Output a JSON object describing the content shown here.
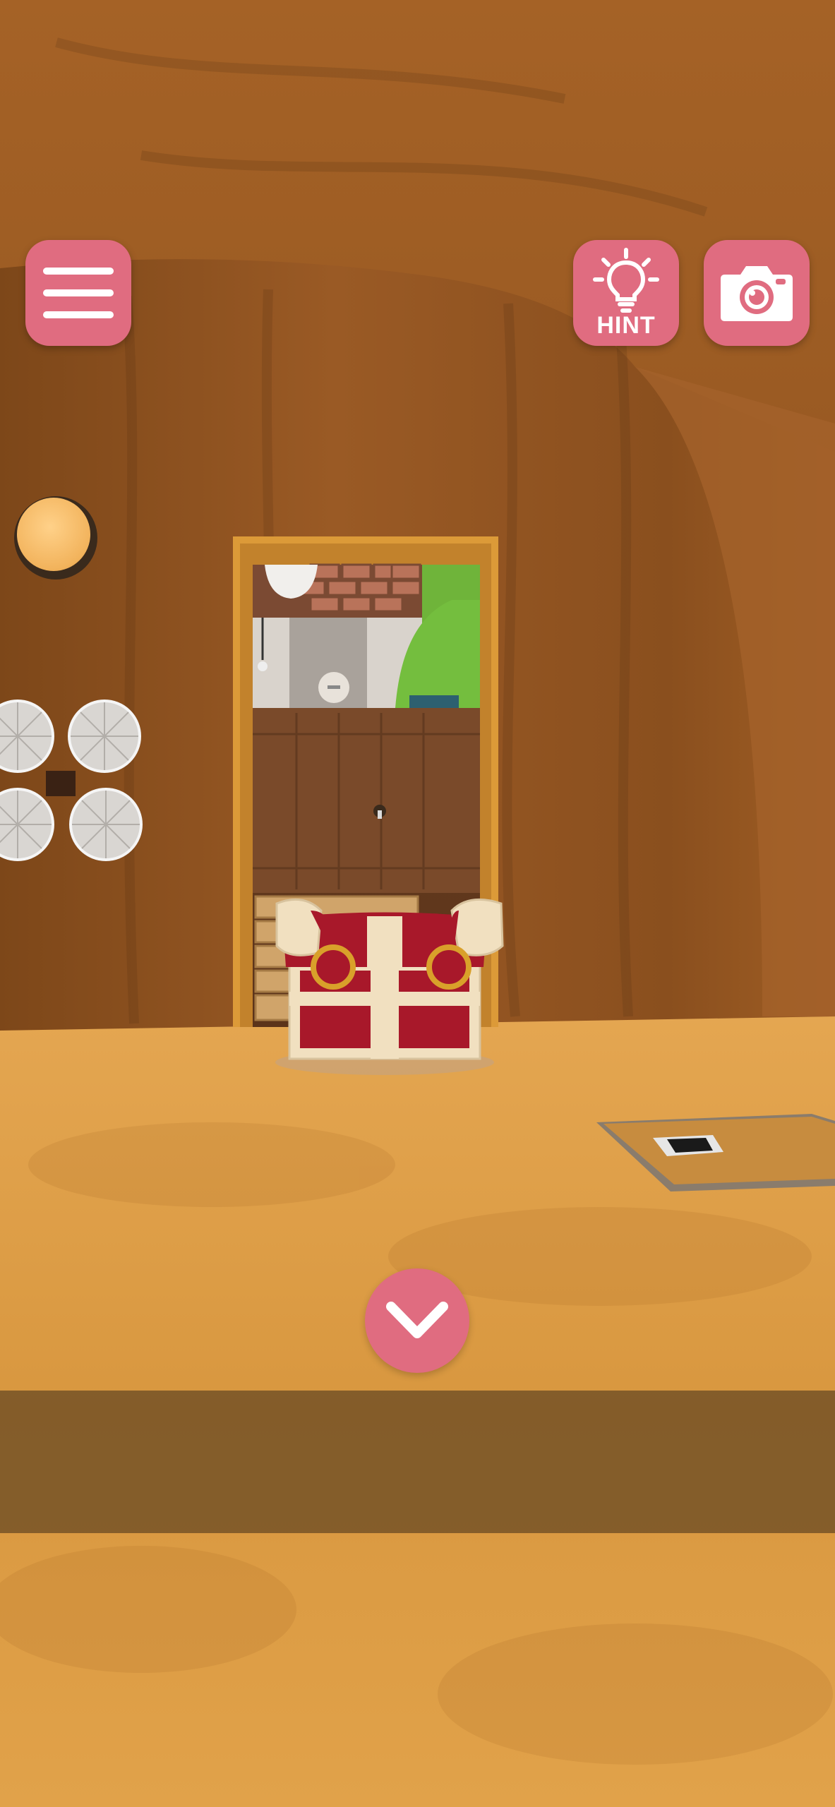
{
  "toolbar": {
    "menu_icon": "hamburger-menu-icon",
    "hint_icon": "lightbulb-icon",
    "hint_label": "HINT",
    "camera_icon": "camera-icon"
  },
  "navigation": {
    "back_icon": "chevron-down-icon"
  },
  "colors": {
    "button_pink": "#e06c80",
    "button_icon": "#ffffff",
    "wall": "#8c5220",
    "floor": "#d99a45",
    "door_frame": "#dc9a38",
    "chest_red": "#a8182a",
    "chest_cream": "#f1e0c0",
    "banner": "#463219"
  },
  "scene": {
    "objects": [
      "wall-coin",
      "wall-dial-top-left",
      "wall-dial-top-right",
      "wall-dial-bottom-left",
      "wall-dial-bottom-right",
      "doorway",
      "treasure-chest",
      "floor-photo"
    ]
  }
}
